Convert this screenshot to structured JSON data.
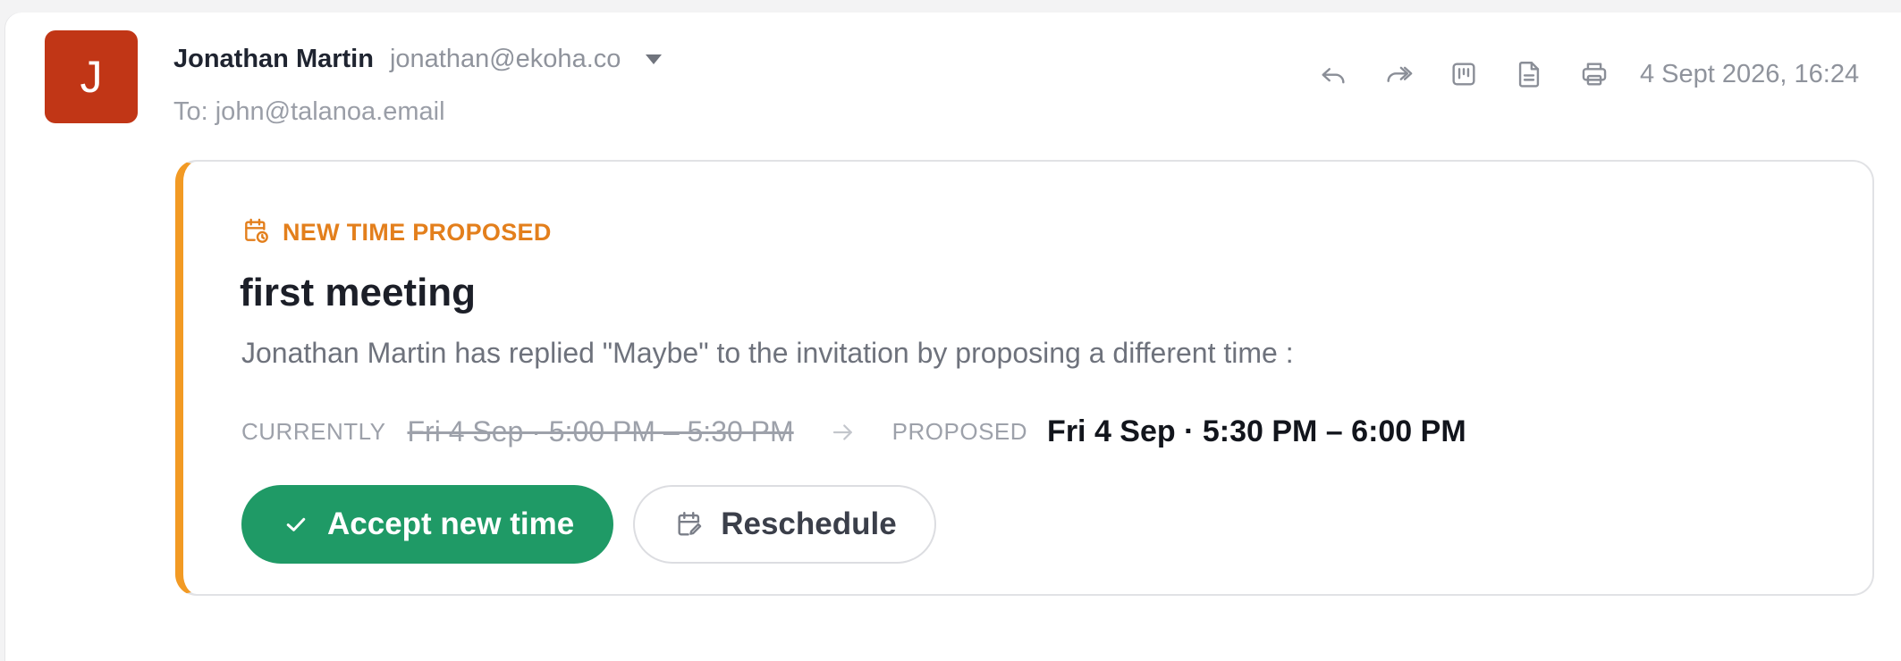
{
  "sender": {
    "avatar_initial": "J",
    "name": "Jonathan Martin",
    "email": "jonathan@ekoha.co",
    "recipient": "To: john@talanoa.email"
  },
  "toolbar": {
    "icons": [
      "reply-icon",
      "forward-icon",
      "kanban-icon",
      "document-icon",
      "print-icon"
    ],
    "timestamp": "4 Sept 2026, 16:24"
  },
  "proposal": {
    "badge": "NEW TIME PROPOSED",
    "title": "first meeting",
    "description": "Jonathan Martin has replied \"Maybe\" to the invitation by proposing a different time :",
    "current_label": "CURRENTLY",
    "current_time": "Fri 4 Sep · 5:00 PM – 5:30 PM",
    "proposed_label": "PROPOSED",
    "proposed_time": "Fri 4 Sep · 5:30 PM – 6:00 PM",
    "accept_label": "Accept new time",
    "reschedule_label": "Reschedule"
  },
  "colors": {
    "avatar": "#c13616",
    "accent_orange": "#f29a24",
    "badge_text": "#e37f1c",
    "accept_green": "#1f9a66"
  }
}
